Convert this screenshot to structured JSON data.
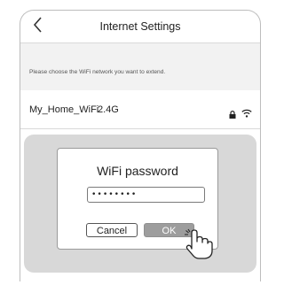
{
  "header": {
    "title": "Internet Settings",
    "back_icon": "chevron-left-icon"
  },
  "hint": "Please choose the WiFi network you want to extend.",
  "network": {
    "ssid": "My_Home_WiFi",
    "band": "2.4G",
    "icons": [
      "lock-icon",
      "wifi-signal-icon"
    ]
  },
  "dialog": {
    "title": "WiFi password",
    "password_value": "••••••••",
    "cancel_label": "Cancel",
    "ok_label": "OK"
  },
  "pointer_icon": "hand-pointer-icon",
  "colors": {
    "overlay": "#d8d8d8",
    "ok_button": "#9d9d9d",
    "hint_band": "#f2f2f2"
  }
}
